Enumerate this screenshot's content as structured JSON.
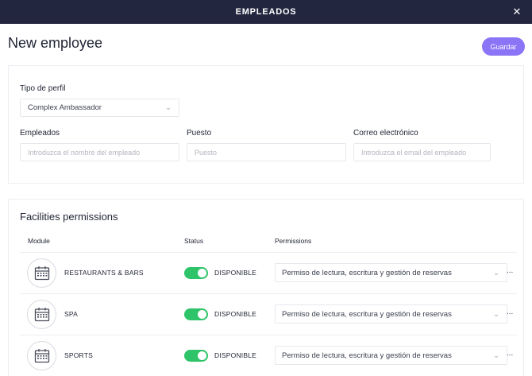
{
  "header": {
    "title": "EMPLEADOS",
    "close_icon": "close-icon"
  },
  "page": {
    "title": "New employee",
    "save_label": "Guardar",
    "accent_color": "#8b74f5"
  },
  "profile_form": {
    "profile_type": {
      "label": "Tipo de perfil",
      "value": "Complex Ambassador"
    },
    "employee": {
      "label": "Empleados",
      "placeholder": "Introduzca el nombre del empleado",
      "value": ""
    },
    "position": {
      "label": "Puesto",
      "placeholder": "Puesto",
      "value": ""
    },
    "email": {
      "label": "Correo electrónico",
      "placeholder": "Introduzca el email del empleado",
      "value": ""
    }
  },
  "permissions": {
    "title": "Facilities permissions",
    "columns": {
      "module": "Module",
      "status": "Status",
      "permissions": "Permissions"
    },
    "rows": [
      {
        "module": "RESTAURANTS & BARS",
        "icon": "calendar-icon",
        "enabled": true,
        "status": "DISPONIBLE",
        "permission": "Permiso de lectura, escritura y gestión de reservas",
        "more": "..."
      },
      {
        "module": "SPA",
        "icon": "calendar-icon",
        "enabled": true,
        "status": "DISPONIBLE",
        "permission": "Permiso de lectura, escritura y gestión de reservas",
        "more": "..."
      },
      {
        "module": "SPORTS",
        "icon": "calendar-icon",
        "enabled": true,
        "status": "DISPONIBLE",
        "permission": "Permiso de lectura, escritura y gestión de reservas",
        "more": "..."
      }
    ],
    "toggle_on_color": "#2fc469"
  }
}
